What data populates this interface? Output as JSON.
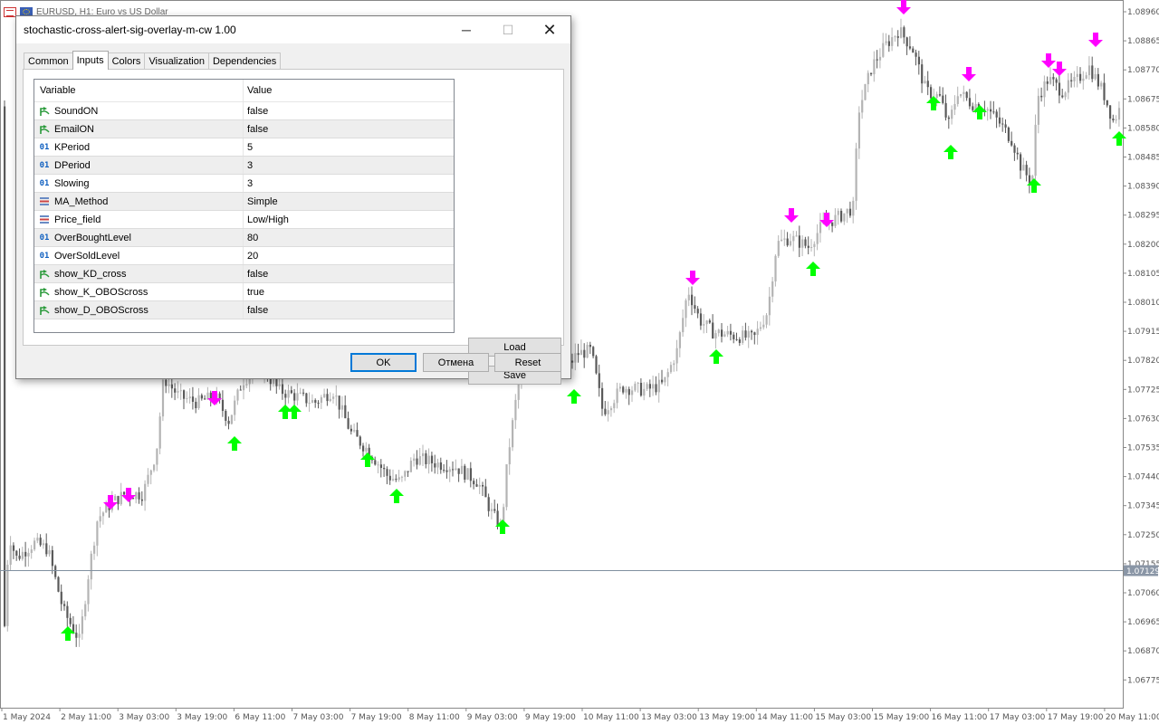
{
  "chart": {
    "window_title": "EURUSD, H1:  Euro vs US Dollar",
    "current_price": "1.07129",
    "price_axis": [
      "1.08960",
      "1.08865",
      "1.08770",
      "1.08675",
      "1.08580",
      "1.08485",
      "1.08390",
      "1.08295",
      "1.08200",
      "1.08105",
      "1.08010",
      "1.07915",
      "1.07820",
      "1.07725",
      "1.07630",
      "1.07535",
      "1.07440",
      "1.07345",
      "1.07250",
      "1.07155",
      "1.07060",
      "1.06965",
      "1.06870",
      "1.06775"
    ],
    "time_axis": [
      "1 May 2024",
      "2 May 11:00",
      "3 May 03:00",
      "3 May 19:00",
      "6 May 11:00",
      "7 May 03:00",
      "7 May 19:00",
      "8 May 11:00",
      "9 May 03:00",
      "9 May 19:00",
      "10 May 11:00",
      "13 May 03:00",
      "13 May 19:00",
      "14 May 11:00",
      "15 May 03:00",
      "15 May 19:00",
      "16 May 11:00",
      "17 May 03:00",
      "17 May 19:00",
      "20 May 11:00"
    ],
    "colors": {
      "up_arrow": "#00ff00",
      "down_arrow": "#ff00ff",
      "candle_bull": "#b4b4b4",
      "candle_bear": "#5a5a5a",
      "price_line": "#8090a0"
    }
  },
  "dialog": {
    "title": "stochastic-cross-alert-sig-overlay-m-cw 1.00",
    "controls": {
      "minimize": "─",
      "maximize": "☐",
      "close": "✕"
    },
    "tabs": [
      {
        "label": "Common"
      },
      {
        "label": "Inputs",
        "active": true
      },
      {
        "label": "Colors"
      },
      {
        "label": "Visualization"
      },
      {
        "label": "Dependencies"
      }
    ],
    "grid": {
      "header_variable": "Variable",
      "header_value": "Value",
      "rows": [
        {
          "variable": "SoundON",
          "value": "false",
          "icon": "bool-icon"
        },
        {
          "variable": "EmailON",
          "value": "false",
          "icon": "bool-icon"
        },
        {
          "variable": "KPeriod",
          "value": "5",
          "icon": "int-icon"
        },
        {
          "variable": "DPeriod",
          "value": "3",
          "icon": "int-icon"
        },
        {
          "variable": "Slowing",
          "value": "3",
          "icon": "int-icon"
        },
        {
          "variable": "MA_Method",
          "value": "Simple",
          "icon": "enum-icon"
        },
        {
          "variable": "Price_field",
          "value": "Low/High",
          "icon": "enum-icon"
        },
        {
          "variable": "OverBoughtLevel",
          "value": "80",
          "icon": "int-icon"
        },
        {
          "variable": "OverSoldLevel",
          "value": "20",
          "icon": "int-icon"
        },
        {
          "variable": "show_KD_cross",
          "value": "false",
          "icon": "bool-icon"
        },
        {
          "variable": "show_K_OBOScross",
          "value": "true",
          "icon": "bool-icon"
        },
        {
          "variable": "show_D_OBOScross",
          "value": "false",
          "icon": "bool-icon"
        }
      ]
    },
    "buttons": {
      "load": "Load",
      "save": "Save",
      "ok": "OK",
      "cancel": "Отмена",
      "reset": "Reset"
    }
  }
}
